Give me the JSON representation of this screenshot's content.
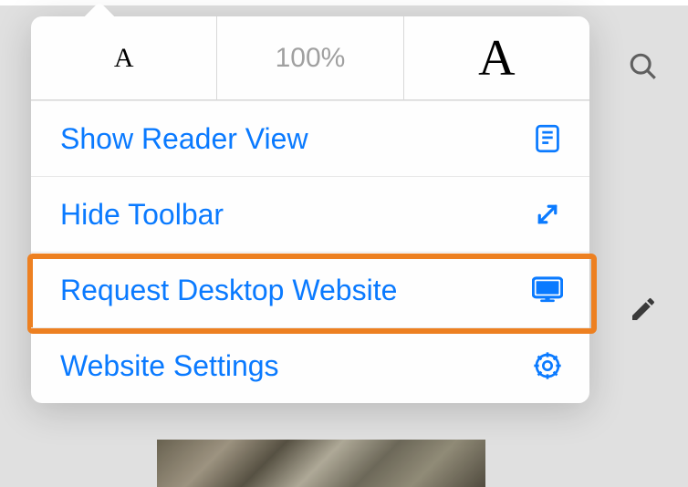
{
  "font_controls": {
    "decrease_label": "A",
    "zoom_level": "100%",
    "increase_label": "A"
  },
  "menu": {
    "show_reader": "Show Reader View",
    "hide_toolbar": "Hide Toolbar",
    "request_desktop": "Request Desktop Website",
    "website_settings": "Website Settings"
  },
  "highlight": "request_desktop"
}
